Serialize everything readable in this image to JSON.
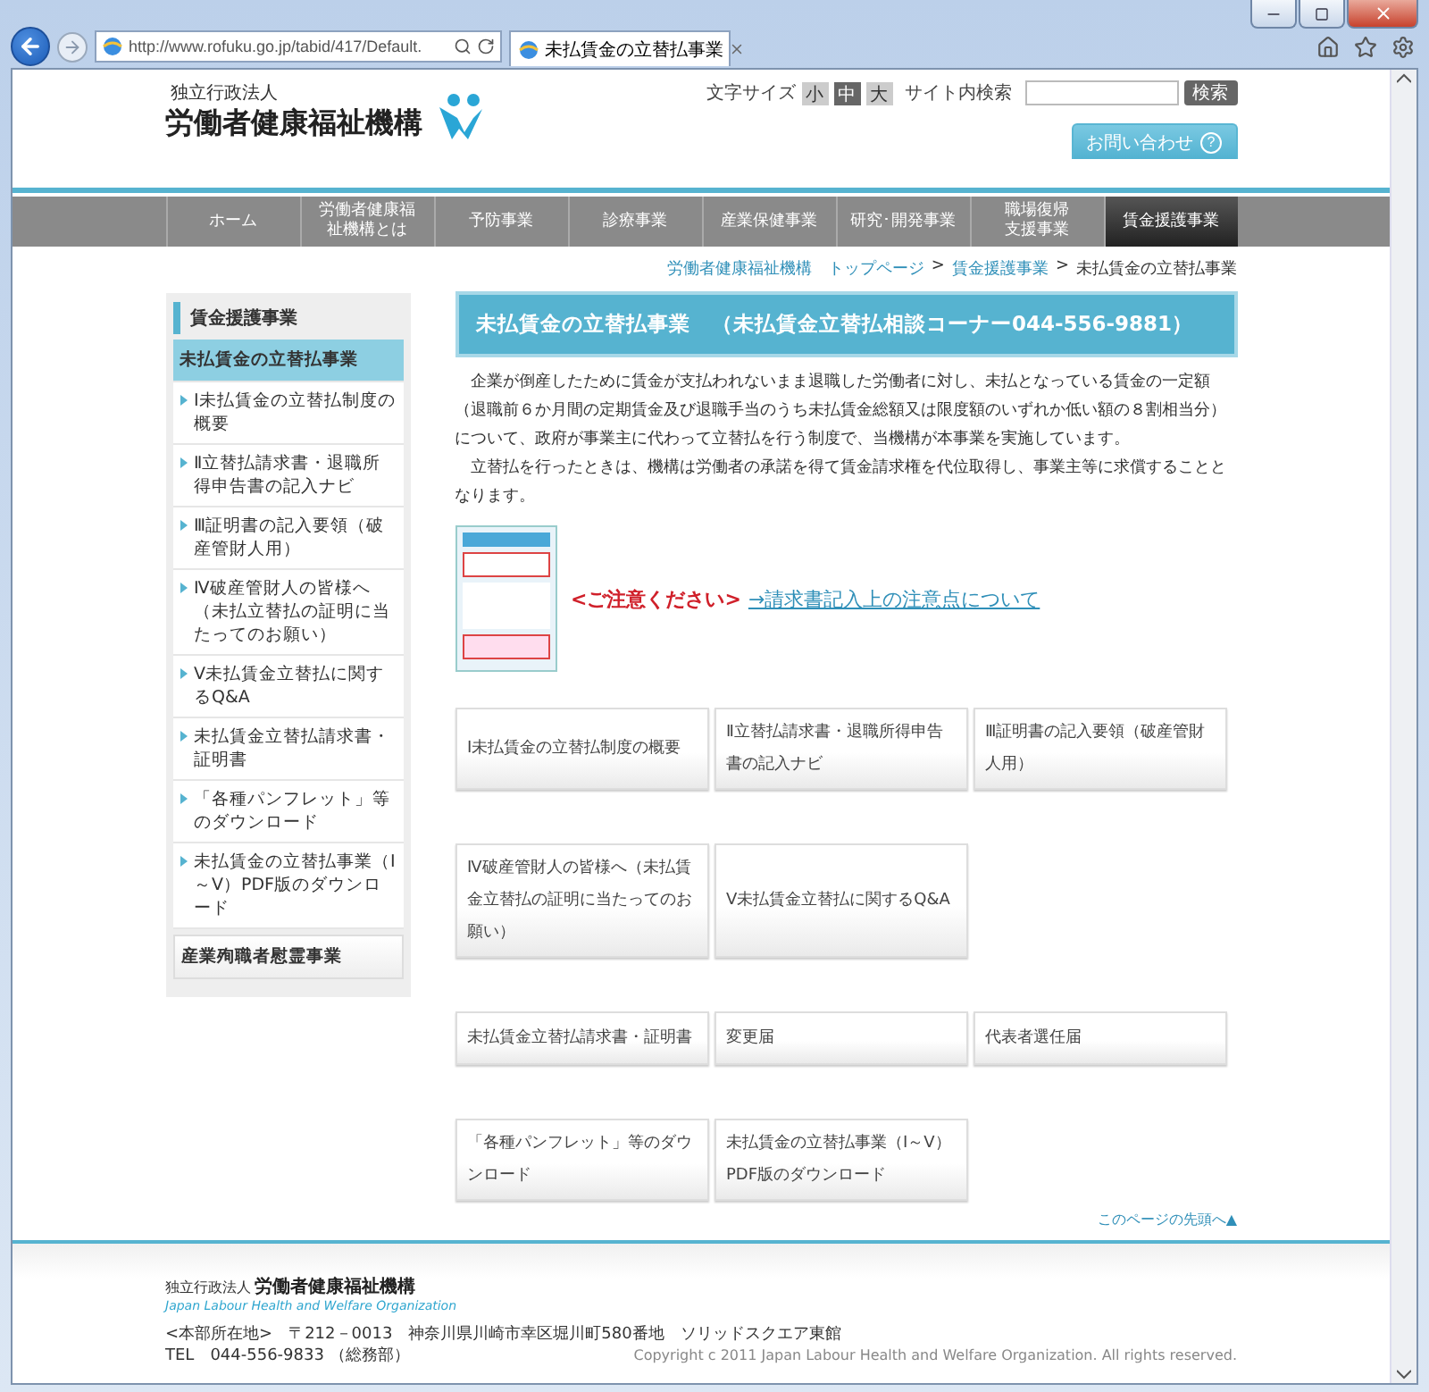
{
  "browser": {
    "url": "http://www.rofuku.go.jp/tabid/417/Default.",
    "tab_title": "未払賃金の立替払事業"
  },
  "header": {
    "org_type": "独立行政法人",
    "org_name": "労働者健康福祉機構",
    "font_size_label": "文字サイズ",
    "font_sizes": [
      {
        "label": "小",
        "selected": false
      },
      {
        "label": "中",
        "selected": true
      },
      {
        "label": "大",
        "selected": false
      }
    ],
    "search_label": "サイト内検索",
    "search_button": "検索",
    "contact_button": "お問い合わせ",
    "contact_icon": "?"
  },
  "nav": [
    {
      "label": "ホーム",
      "selected": false
    },
    {
      "label": "労働者健康福祉機構とは",
      "selected": false
    },
    {
      "label": "予防事業",
      "selected": false
    },
    {
      "label": "診療事業",
      "selected": false
    },
    {
      "label": "産業保健事業",
      "selected": false
    },
    {
      "label": "研究･開発事業",
      "selected": false
    },
    {
      "label": "職場復帰支援事業",
      "selected": false
    },
    {
      "label": "賃金援護事業",
      "selected": true
    }
  ],
  "breadcrumb": [
    {
      "label": "労働者健康福祉機構　トップページ",
      "kind": "link"
    },
    {
      "label": ">",
      "kind": "separator"
    },
    {
      "label": "賃金援護事業",
      "kind": "link"
    },
    {
      "label": ">",
      "kind": "separator"
    },
    {
      "label": "未払賃金の立替払事業",
      "kind": "current"
    }
  ],
  "sidebar": {
    "title": "賃金援護事業",
    "items": [
      {
        "label": "未払賃金の立替払事業",
        "kind": "section",
        "selected": true
      },
      {
        "label": "Ⅰ未払賃金の立替払制度の概要",
        "kind": "link",
        "selected": false
      },
      {
        "label": "Ⅱ立替払請求書・退職所得申告書の記入ナビ",
        "kind": "link",
        "selected": false
      },
      {
        "label": "Ⅲ証明書の記入要領（破産管財人用）",
        "kind": "link",
        "selected": false
      },
      {
        "label": "Ⅳ破産管財人の皆様へ（未払立替払の証明に当たってのお願い）",
        "kind": "link",
        "selected": false
      },
      {
        "label": "Ⅴ未払賃金立替払に関するQ&A",
        "kind": "link",
        "selected": false
      },
      {
        "label": "未払賃金立替払請求書・証明書",
        "kind": "link",
        "selected": false
      },
      {
        "label": "「各種パンフレット」等のダウンロード",
        "kind": "link",
        "selected": false
      },
      {
        "label": "未払賃金の立替払事業（Ⅰ～Ⅴ）PDF版のダウンロード",
        "kind": "link",
        "selected": false
      },
      {
        "label": "産業殉職者慰霊事業",
        "kind": "section",
        "selected": false
      }
    ]
  },
  "main": {
    "title": "未払賃金の立替払事業　（未払賃金立替払相談コーナー044-556-9881）",
    "paragraphs": [
      "企業が倒産したために賃金が支払われないまま退職した労働者に対し、未払となっている賃金の一定額（退職前６か月間の定期賃金及び退職手当のうち未払賃金総額又は限度額のいずれか低い額の８割相当分）について、政府が事業主に代わって立替払を行う制度で、当機構が本事業を実施しています。",
      "立替払を行ったときは、機構は労働者の承諾を得て賃金請求権を代位取得し、事業主等に求償することとなります。"
    ],
    "notice": {
      "warning": "<ご注意ください>",
      "link": "→請求書記入上の注意点について"
    },
    "tile_rows": [
      [
        "Ⅰ未払賃金の立替払制度の概要",
        "Ⅱ立替払請求書・退職所得申告書の記入ナビ",
        "Ⅲ証明書の記入要領（破産管財人用）"
      ],
      [
        "Ⅳ破産管財人の皆様へ（未払賃金立替払の証明に当たってのお願い）",
        "Ⅴ未払賃金立替払に関するQ&A"
      ],
      [
        "未払賃金立替払請求書・証明書",
        "変更届",
        "代表者選任届"
      ],
      [
        "「各種パンフレット」等のダウンロード",
        "未払賃金の立替払事業（Ⅰ～Ⅴ）PDF版のダウンロード"
      ]
    ]
  },
  "page_top": "このページの先頭へ▲",
  "footer": {
    "org_type": "独立行政法人",
    "org_name": "労働者健康福祉機構",
    "org_name_en": "Japan Labour Health and Welfare Organization",
    "address": "<本部所在地>　〒212－0013　神奈川県川崎市幸区堀川町580番地　ソリッドスクエア東館",
    "tel": "TEL　044-556-9833 （総務部）",
    "copyright": "Copyright c 2011 Japan Labour Health and Welfare Organization. All rights reserved."
  }
}
